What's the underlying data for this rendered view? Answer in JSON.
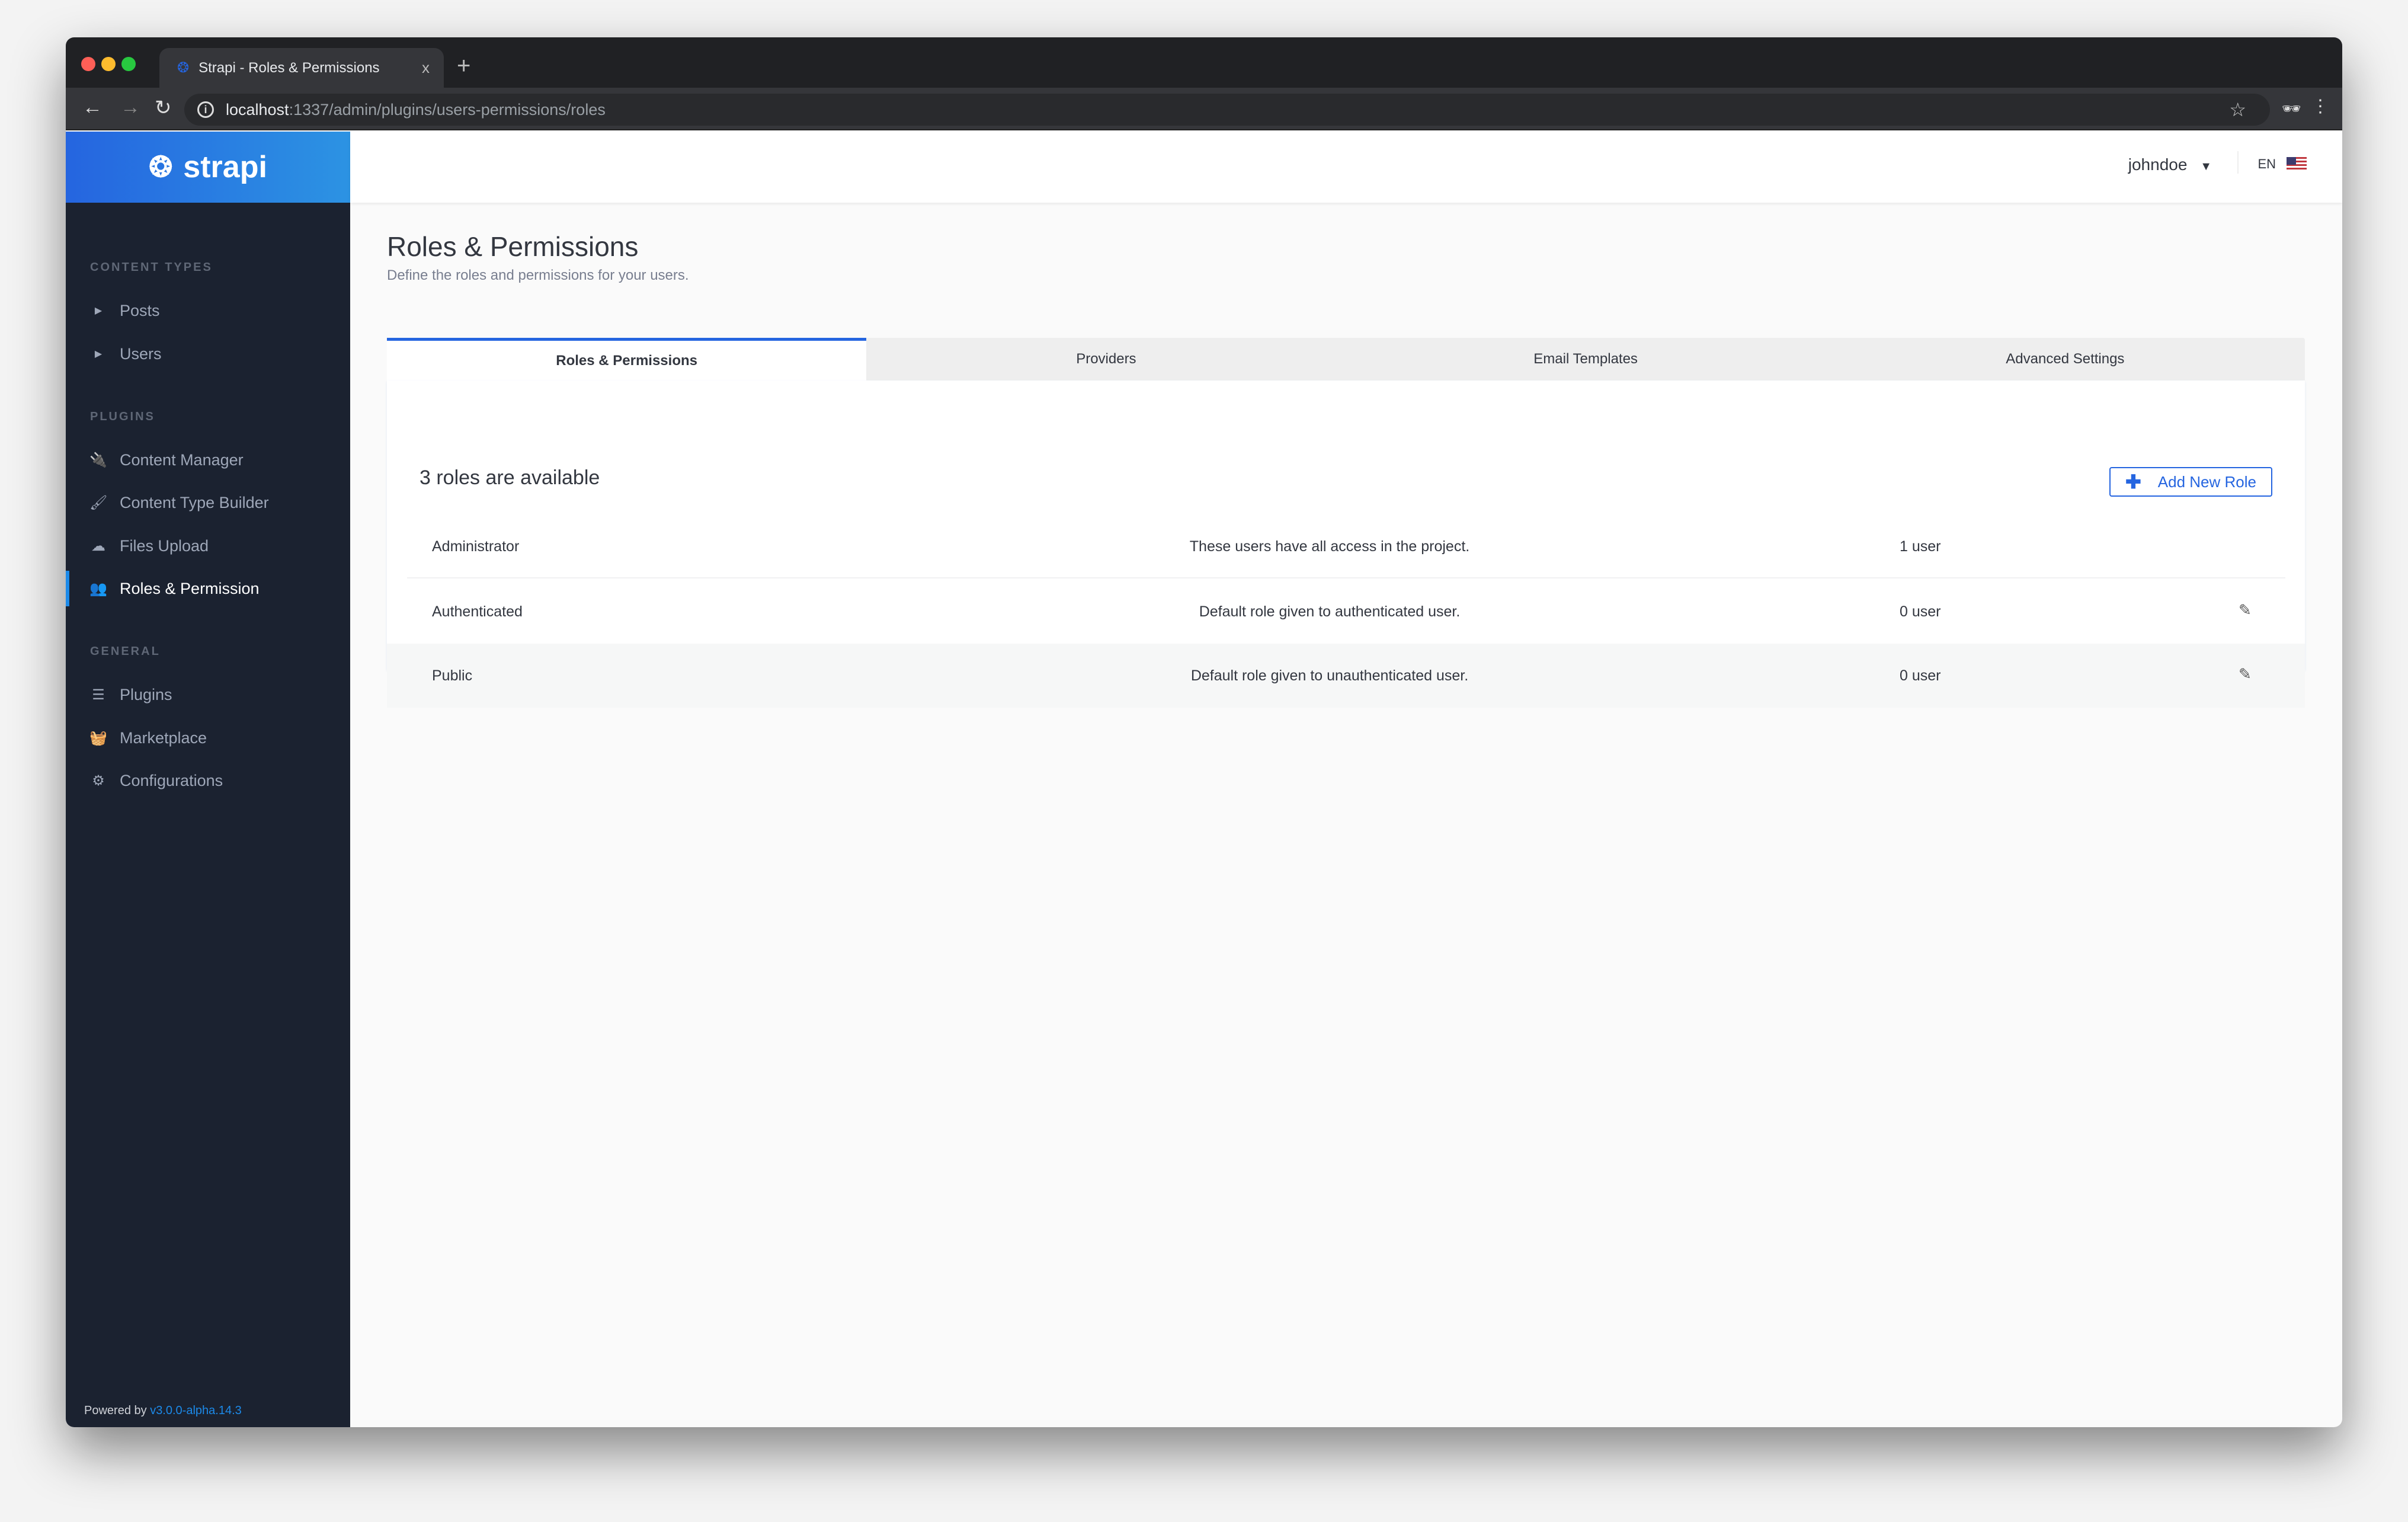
{
  "browser": {
    "tab_title": "Strapi - Roles & Permissions",
    "url_host": "localhost",
    "url_path": ":1337/admin/plugins/users-permissions/roles",
    "close": "x",
    "new_tab": "+"
  },
  "sidebar": {
    "brand": "strapi",
    "sections": [
      {
        "title": "CONTENT TYPES"
      },
      {
        "title": "PLUGINS"
      },
      {
        "title": "GENERAL"
      }
    ],
    "items": [
      {
        "label": "Posts",
        "icon": "caret-right-icon"
      },
      {
        "label": "Users",
        "icon": "caret-right-icon"
      },
      {
        "label": "Content Manager",
        "icon": "plug-icon"
      },
      {
        "label": "Content Type Builder",
        "icon": "paint-brush-icon"
      },
      {
        "label": "Files Upload",
        "icon": "cloud-upload-icon"
      },
      {
        "label": "Roles & Permission",
        "icon": "users-icon",
        "active": true
      },
      {
        "label": "Plugins",
        "icon": "list-icon"
      },
      {
        "label": "Marketplace",
        "icon": "basket-icon"
      },
      {
        "label": "Configurations",
        "icon": "gear-icon"
      }
    ],
    "powered_by": "Powered by",
    "version": "v3.0.0-alpha.14.3"
  },
  "header": {
    "user": "johndoe",
    "lang": "EN"
  },
  "page": {
    "title": "Roles & Permissions",
    "subtitle": "Define the roles and permissions for your users.",
    "tabs": [
      "Roles & Permissions",
      "Providers",
      "Email Templates",
      "Advanced Settings"
    ],
    "count_label": "3 roles are available",
    "add_button": "Add New Role",
    "roles": [
      {
        "name": "Administrator",
        "description": "These users have all access in the project.",
        "users": "1 user"
      },
      {
        "name": "Authenticated",
        "description": "Default role given to authenticated user.",
        "users": "0 user"
      },
      {
        "name": "Public",
        "description": "Default role given to unauthenticated user.",
        "users": "0 user"
      }
    ]
  },
  "colors": {
    "accent": "#2565e0",
    "sidebar": "#1b2230",
    "active_indicator": "#1c8ae9"
  }
}
